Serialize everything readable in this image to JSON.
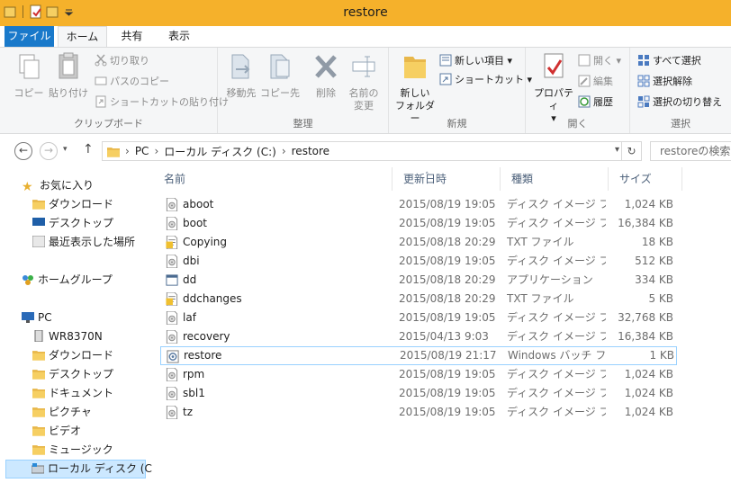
{
  "window": {
    "title": "restore"
  },
  "tabs": [
    {
      "label": "ファイル"
    },
    {
      "label": "ホーム"
    },
    {
      "label": "共有"
    },
    {
      "label": "表示"
    }
  ],
  "ribbon": {
    "clipboard": {
      "label": "クリップボード",
      "copy": "コピー",
      "paste": "貼り付け",
      "cut": "切り取り",
      "copy_path": "パスのコピー",
      "paste_shortcut": "ショートカットの貼り付け"
    },
    "organize": {
      "label": "整理",
      "move_to": "移動先",
      "copy_to": "コピー先",
      "delete": "削除",
      "rename": "名前の\n変更",
      "rename_l1": "名前の",
      "rename_l2": "変更"
    },
    "new": {
      "label": "新規",
      "new_folder_l1": "新しい",
      "new_folder_l2": "フォルダー",
      "new_item": "新しい項目",
      "shortcut": "ショートカット"
    },
    "open": {
      "label": "開く",
      "properties": "プロパティ",
      "open": "開く",
      "edit": "編集",
      "history": "履歴"
    },
    "select": {
      "label": "選択",
      "select_all": "すべて選択",
      "select_none": "選択解除",
      "invert": "選択の切り替え"
    }
  },
  "address": {
    "segments": [
      "PC",
      "ローカル ディスク (C:)",
      "restore"
    ],
    "search_placeholder": "restoreの検索"
  },
  "nav": {
    "favorites": "お気に入り",
    "downloads": "ダウンロード",
    "desktop": "デスクトップ",
    "recent": "最近表示した場所",
    "homegroup": "ホームグループ",
    "pc": "PC",
    "wr": "WR8370N",
    "pc_downloads": "ダウンロード",
    "pc_desktop": "デスクトップ",
    "documents": "ドキュメント",
    "pictures": "ピクチャ",
    "videos": "ビデオ",
    "music": "ミュージック",
    "local_disk": "ローカル ディスク (C:)"
  },
  "columns": {
    "name": "名前",
    "date": "更新日時",
    "type": "種類",
    "size": "サイズ"
  },
  "files": [
    {
      "name": "aboot",
      "date": "2015/08/19 19:05",
      "type": "ディスク イメージ ファ...",
      "size": "1,024 KB",
      "icon": "disk-image-icon"
    },
    {
      "name": "boot",
      "date": "2015/08/19 19:05",
      "type": "ディスク イメージ ファ...",
      "size": "16,384 KB",
      "icon": "disk-image-icon"
    },
    {
      "name": "Copying",
      "date": "2015/08/18 20:29",
      "type": "TXT ファイル",
      "size": "18 KB",
      "icon": "text-file-icon"
    },
    {
      "name": "dbi",
      "date": "2015/08/19 19:05",
      "type": "ディスク イメージ ファ...",
      "size": "512 KB",
      "icon": "disk-image-icon"
    },
    {
      "name": "dd",
      "date": "2015/08/18 20:29",
      "type": "アプリケーション",
      "size": "334 KB",
      "icon": "application-icon"
    },
    {
      "name": "ddchanges",
      "date": "2015/08/18 20:29",
      "type": "TXT ファイル",
      "size": "5 KB",
      "icon": "text-file-icon"
    },
    {
      "name": "laf",
      "date": "2015/08/19 19:05",
      "type": "ディスク イメージ ファ...",
      "size": "32,768 KB",
      "icon": "disk-image-icon"
    },
    {
      "name": "recovery",
      "date": "2015/04/13 9:03",
      "type": "ディスク イメージ ファ...",
      "size": "16,384 KB",
      "icon": "disk-image-icon"
    },
    {
      "name": "restore",
      "date": "2015/08/19 21:17",
      "type": "Windows バッチ フ...",
      "size": "1 KB",
      "icon": "batch-file-icon"
    },
    {
      "name": "rpm",
      "date": "2015/08/19 19:05",
      "type": "ディスク イメージ ファ...",
      "size": "1,024 KB",
      "icon": "disk-image-icon"
    },
    {
      "name": "sbl1",
      "date": "2015/08/19 19:05",
      "type": "ディスク イメージ ファ...",
      "size": "1,024 KB",
      "icon": "disk-image-icon"
    },
    {
      "name": "tz",
      "date": "2015/08/19 19:05",
      "type": "ディスク イメージ ファ...",
      "size": "1,024 KB",
      "icon": "disk-image-icon"
    }
  ],
  "colors": {
    "title_bar": "#f5b12b",
    "file_tab": "#1979ca",
    "selection": "#cce8ff",
    "selection_border": "#99d1ff"
  }
}
